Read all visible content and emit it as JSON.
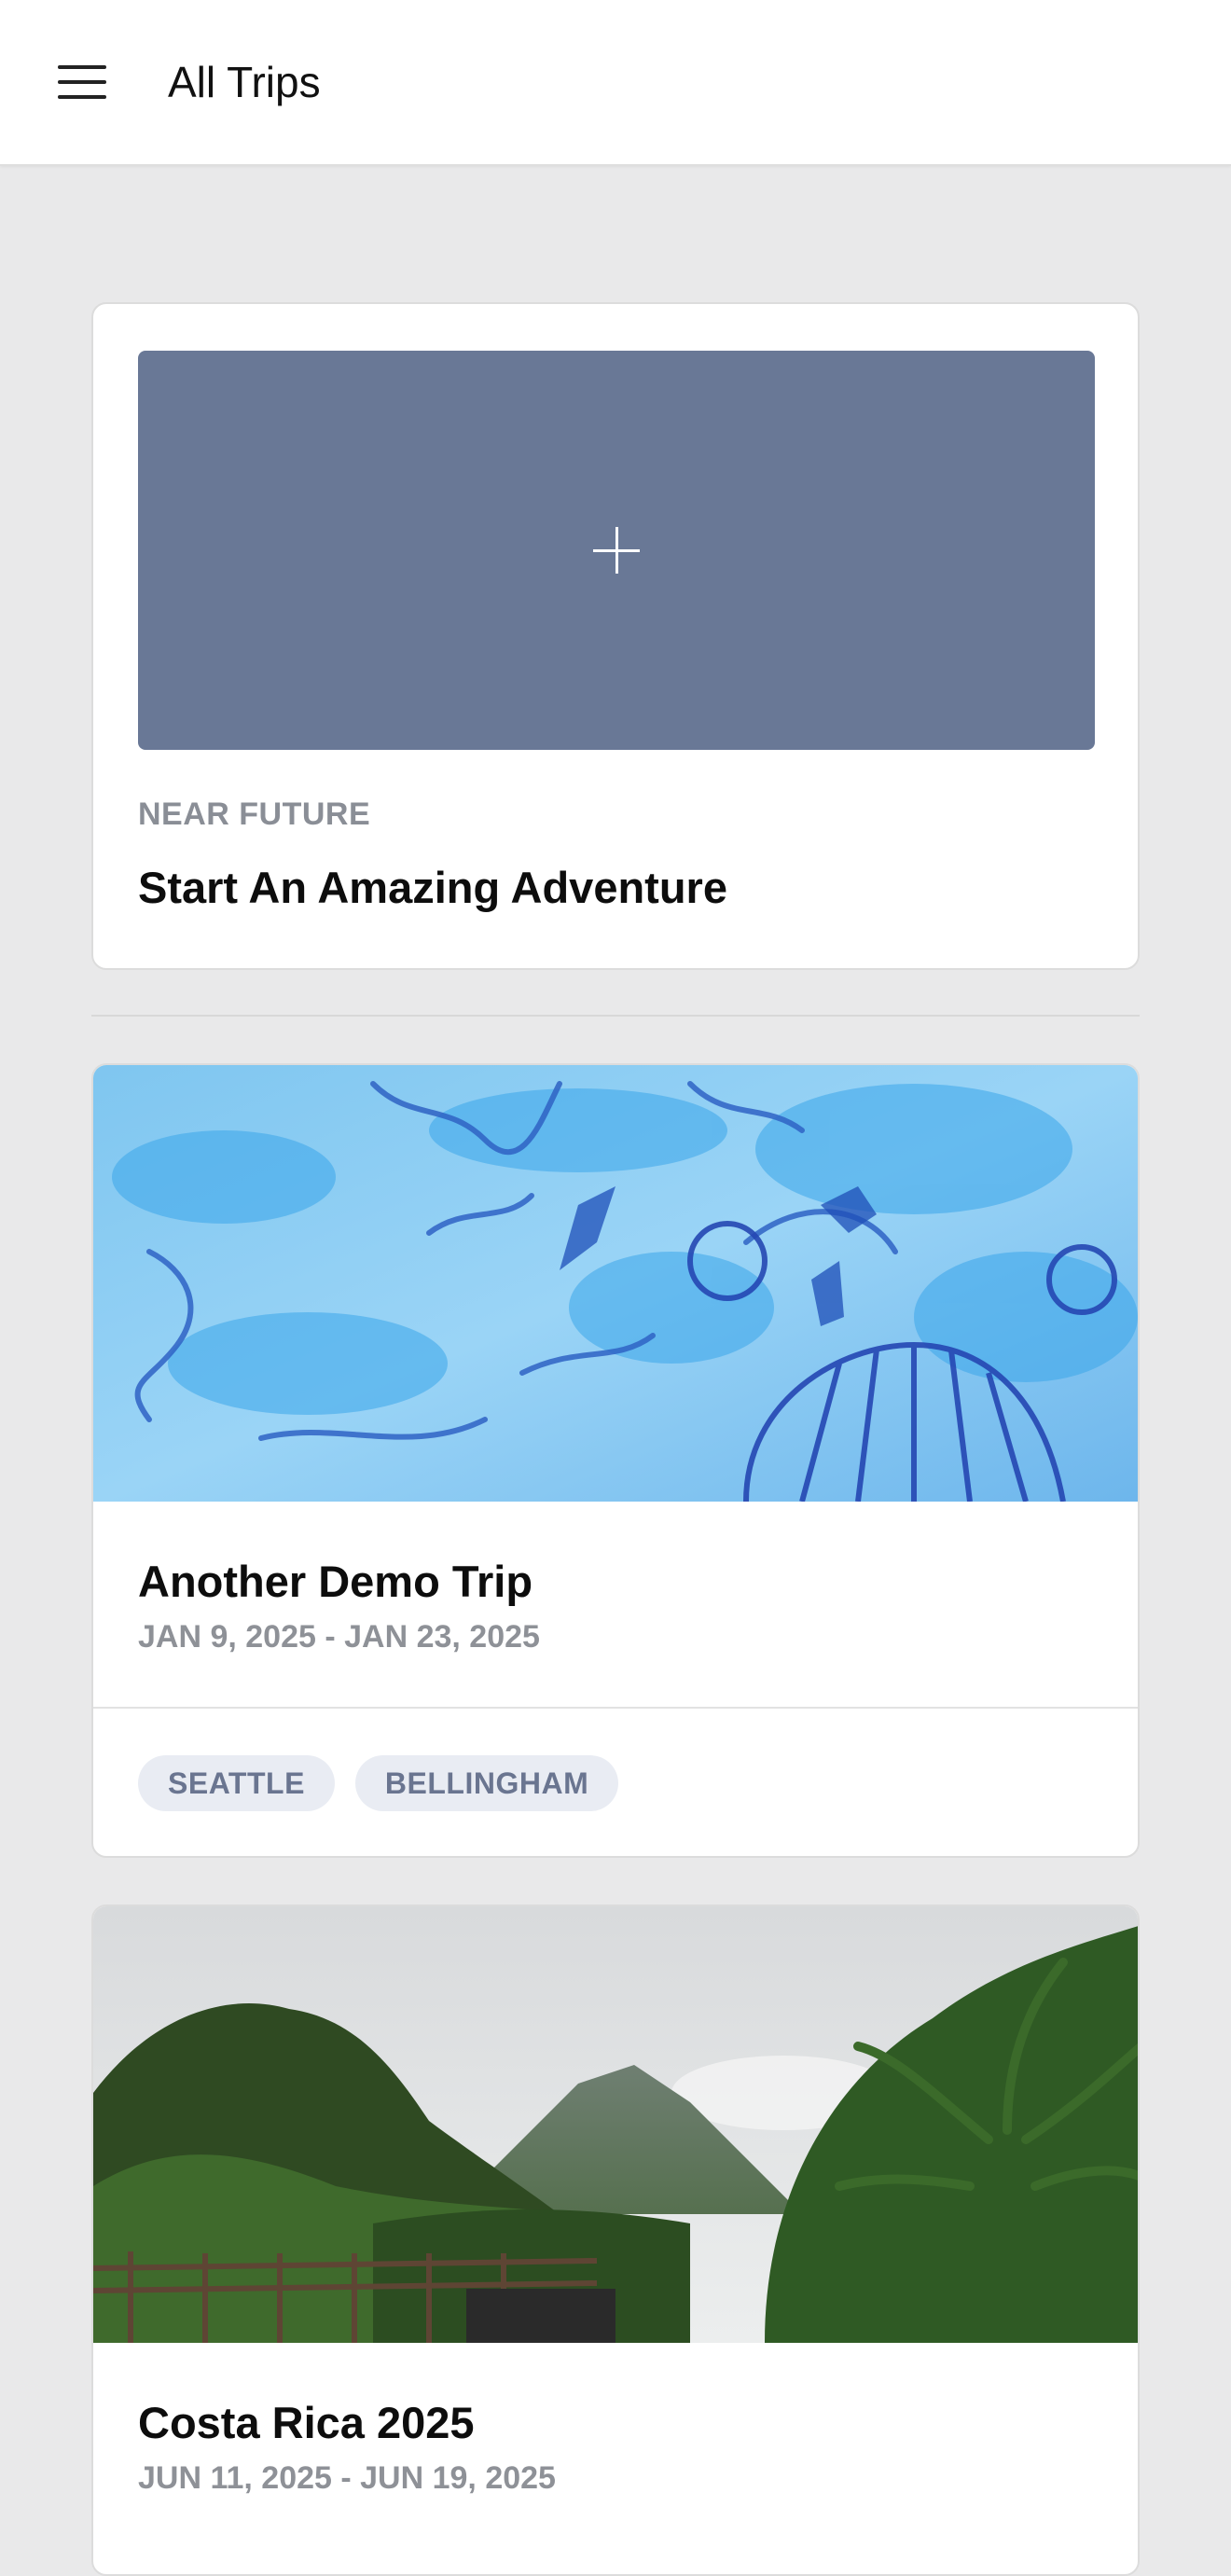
{
  "header": {
    "title": "All Trips",
    "menu_icon": "hamburger-menu-icon"
  },
  "new_trip_card": {
    "icon": "plus-icon",
    "eyebrow": "NEAR FUTURE",
    "title": "Start An Amazing Adventure",
    "tile_color": "#697896"
  },
  "trips": [
    {
      "name": "Another Demo Trip",
      "dates": "JAN 9, 2025 - JAN 23, 2025",
      "tags": [
        "SEATTLE",
        "BELLINGHAM"
      ]
    },
    {
      "name": "Costa Rica 2025",
      "dates": "JUN 11, 2025 - JUN 19, 2025"
    }
  ]
}
